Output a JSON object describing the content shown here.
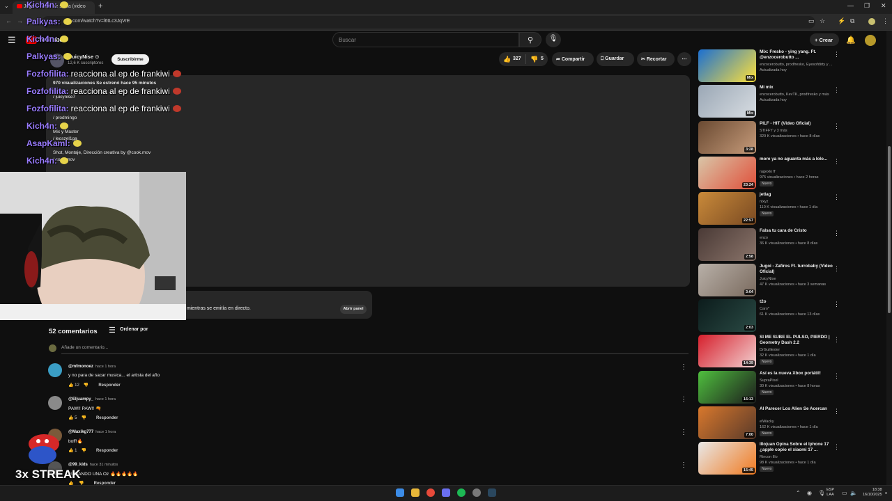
{
  "browser": {
    "tab_title": "Jugoi - nadie se salva (video",
    "new_tab_icon": "plus-icon",
    "url": "com/watch?v=l6tLc3JqVrE",
    "window_controls": [
      "—",
      "❐",
      "✕"
    ]
  },
  "header": {
    "logo_text": "YouTube",
    "search_placeholder": "Buscar",
    "create_label": "Crear"
  },
  "video": {
    "channel_name": "JuicyNise",
    "subscribers": "12,6 K suscriptores",
    "subscribe_label": "Suscribirme",
    "likes": "327",
    "dislikes": "5",
    "share_label": "Compartir",
    "save_label": "Guardar",
    "clip_label": "Recortar",
    "description": {
      "stats": "970 visualizaciones  Se estrenó hace 95 minutos",
      "lines": [
        "/ juicynise7",
        "/ prodmingo",
        "Mix y Master",
        "/ leoszel1ga",
        "Shot, Montaje, Dirección creativa by @cook.mov",
        "/ cook.mov"
      ]
    },
    "chat_replay_text": "mientras se emitía en directo.",
    "open_panel_label": "Abrir panel"
  },
  "comments": {
    "count_label": "52 comentarios",
    "sort_label": "Ordenar por",
    "add_placeholder": "Añade un comentario...",
    "items": [
      {
        "author": "@mfmonoez",
        "time": "hace 1 hora",
        "text": "y no para de sacar musica... el artista del año",
        "likes": "12",
        "reply": "Responder",
        "avatar_color": "#3a9dc4"
      },
      {
        "author": "@Eljuampy_",
        "time": "hace 1 hora",
        "text": "PAW!! PAW!! 🔫",
        "likes": "5",
        "reply": "Responder",
        "avatar_color": "#8a8a8a"
      },
      {
        "author": "@Maxikg777",
        "time": "hace 1 hora",
        "text": "boff!🔥",
        "likes": "1",
        "reply": "Responder",
        "avatar_color": "#7a5a3a"
      },
      {
        "author": "@99_kids",
        "time": "hace 31 minutos",
        "text": "FUMANDO UNA Oz 🔥🔥🔥🔥🔥",
        "likes": "",
        "reply": "Responder",
        "avatar_color": "#555"
      }
    ]
  },
  "recommendations": [
    {
      "title": "Mix: Fresko - ying yang. Ft. @enzocerobutto ...",
      "meta1": "enzocerobutto, prodfresko, Eyesofdirty y ...",
      "meta2": "Actualizada hoy",
      "duration": "Mix",
      "badge": "",
      "colors": [
        "#1b6fd1",
        "#ffe13a"
      ]
    },
    {
      "title": "Mi mix",
      "meta1": "enzocerobutto, KevTK, prodfresko y más",
      "meta2": "Actualizada hoy",
      "duration": "Mix",
      "badge": "",
      "colors": [
        "#9aa7b5",
        "#d8dde2"
      ]
    },
    {
      "title": "PILF - HIT (Video Oficial)",
      "meta1": "STIFFY y 3 más",
      "meta2": "329 K visualizaciones • hace 8 días",
      "duration": "3:28",
      "badge": "",
      "colors": [
        "#6a4a32",
        "#c69b7a"
      ]
    },
    {
      "title": "more ya no aguanta más a lolo...",
      "meta1": "ragexlo ff",
      "meta2": "975 visualizaciones • hace 2 horas",
      "duration": "23:24",
      "badge": "Nuevo",
      "colors": [
        "#d9c6a8",
        "#e04f3a"
      ]
    },
    {
      "title": "jetlag",
      "meta1": "nlxyz",
      "meta2": "110 K visualizaciones • hace 1 día",
      "duration": "22:57",
      "badge": "Nuevo",
      "colors": [
        "#c98a3a",
        "#7a4a22"
      ]
    },
    {
      "title": "Falsa tu cara de Cristo",
      "meta1": "enzo",
      "meta2": "36 K visualizaciones • hace 8 días",
      "duration": "2:58",
      "badge": "",
      "colors": [
        "#4a3a36",
        "#8a746a"
      ]
    },
    {
      "title": "Jugoi - Zafiros Ft. turrobaby (Video Oficial)",
      "meta1": "JuicyNise",
      "meta2": "47 K visualizaciones • hace 3 semanas",
      "duration": "3:04",
      "badge": "",
      "colors": [
        "#b8b0a8",
        "#7a6a5e"
      ]
    },
    {
      "title": "t2o",
      "meta1": "Caro*",
      "meta2": "61 K visualizaciones • hace 13 días",
      "duration": "2:03",
      "badge": "",
      "colors": [
        "#0c1c1c",
        "#2a4a44"
      ]
    },
    {
      "title": "SI ME SUBE EL PULSO, PIERDO | Geometry Dash 2.2",
      "meta1": "DrGuillester",
      "meta2": "32 K visualizaciones • hace 1 día",
      "duration": "14:39",
      "badge": "Nuevo",
      "colors": [
        "#d61f2c",
        "#f2d0d0"
      ]
    },
    {
      "title": "Así es la nueva Xbox portátil!",
      "meta1": "SupraPixel",
      "meta2": "30 K visualizaciones • hace 8 horas",
      "duration": "16:13",
      "badge": "Nuevo",
      "colors": [
        "#4fbf3e",
        "#1d1d1d"
      ]
    },
    {
      "title": "Al Parecer Los Alien Se Acercan",
      "meta1": "elWacky",
      "meta2": "162 K visualizaciones • hace 1 día",
      "duration": "7:00",
      "badge": "Nuevo",
      "colors": [
        "#d8782c",
        "#5a3a2a"
      ]
    },
    {
      "title": "Illojuan Opina Sobre el Iphone 17 ¿apple copio el xiaomi 17 ...",
      "meta1": "Rincon Illo",
      "meta2": "98 K visualizaciones • hace 1 día",
      "duration": "15:45",
      "badge": "Nuevo",
      "colors": [
        "#e8e8e8",
        "#f07a20"
      ]
    }
  ],
  "stream_overlay": {
    "chat": [
      {
        "name": "Kich4n:",
        "msg": ""
      },
      {
        "name": "Palkyas:",
        "msg": ""
      },
      {
        "name": "Kich4n:",
        "msg": ""
      },
      {
        "name": "Palkyas:",
        "msg": ""
      },
      {
        "name": "Fozfofilita:",
        "msg": "reacciona al ep de frankiwi"
      },
      {
        "name": "Fozfofilita:",
        "msg": "reacciona al ep de frankiwi"
      },
      {
        "name": "Fozfofilita:",
        "msg": "reacciona al ep de frankiwi"
      },
      {
        "name": "Kich4n:",
        "msg": ""
      },
      {
        "name": "AsapKaml:",
        "msg": ""
      },
      {
        "name": "Kich4n:",
        "msg": ""
      }
    ],
    "streak_label": "3x STREAK"
  },
  "taskbar": {
    "lang_line1": "ESP",
    "lang_line2": "LAA",
    "time": "18:38",
    "date": "16/10/2025"
  }
}
